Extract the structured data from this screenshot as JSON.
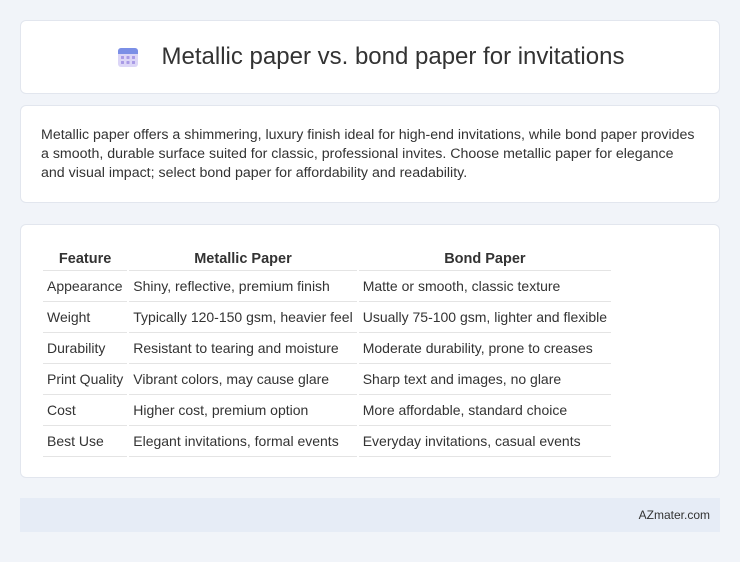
{
  "header": {
    "title": "Metallic paper vs. bond paper for invitations",
    "icon": "calendar-icon"
  },
  "intro": {
    "text": "Metallic paper offers a shimmering, luxury finish ideal for high-end invitations, while bond paper provides a smooth, durable surface suited for classic, professional invites. Choose metallic paper for elegance and visual impact; select bond paper for affordability and readability."
  },
  "table": {
    "headers": [
      "Feature",
      "Metallic Paper",
      "Bond Paper"
    ],
    "rows": [
      [
        "Appearance",
        "Shiny, reflective, premium finish",
        "Matte or smooth, classic texture"
      ],
      [
        "Weight",
        "Typically 120-150 gsm, heavier feel",
        "Usually 75-100 gsm, lighter and flexible"
      ],
      [
        "Durability",
        "Resistant to tearing and moisture",
        "Moderate durability, prone to creases"
      ],
      [
        "Print Quality",
        "Vibrant colors, may cause glare",
        "Sharp text and images, no glare"
      ],
      [
        "Cost",
        "Higher cost, premium option",
        "More affordable, standard choice"
      ],
      [
        "Best Use",
        "Elegant invitations, formal events",
        "Everyday invitations, casual events"
      ]
    ]
  },
  "footer": {
    "brand": "AZmater.com"
  }
}
